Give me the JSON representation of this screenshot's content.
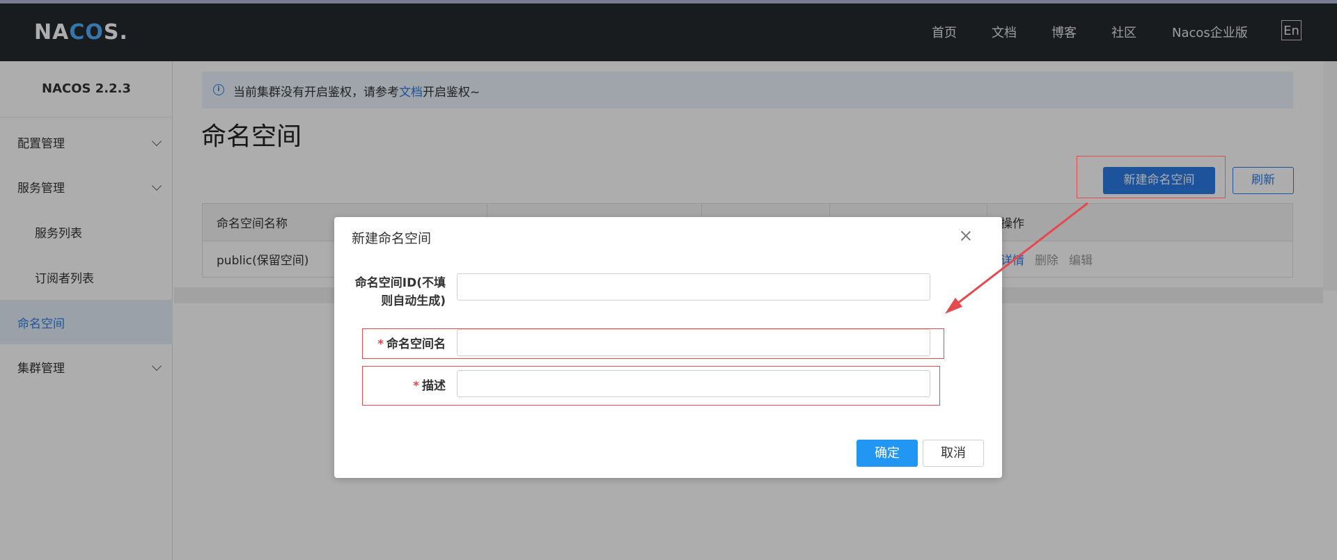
{
  "header": {
    "logo_prefix": "NA",
    "logo_accent": "CO",
    "logo_suffix": "S.",
    "nav": [
      "首页",
      "文档",
      "博客",
      "社区",
      "Nacos企业版"
    ],
    "lang_button": "En"
  },
  "sidebar": {
    "version": "NACOS 2.2.3",
    "items": [
      {
        "label": "配置管理",
        "expandable": true
      },
      {
        "label": "服务管理",
        "expandable": true
      },
      {
        "label": "服务列表",
        "expandable": false
      },
      {
        "label": "订阅者列表",
        "expandable": false
      },
      {
        "label": "命名空间",
        "expandable": false,
        "active": true
      },
      {
        "label": "集群管理",
        "expandable": true
      }
    ]
  },
  "notice": {
    "text_before": "当前集群没有开启鉴权，请参考",
    "link": "文档",
    "text_after": "开启鉴权~"
  },
  "page": {
    "title": "命名空间",
    "new_button": "新建命名空间",
    "refresh_button": "刷新"
  },
  "table": {
    "columns": [
      "命名空间名称",
      "",
      "",
      "",
      "操作"
    ],
    "rows": [
      {
        "name": "public(保留空间)",
        "ops": [
          "详情",
          "删除",
          "编辑"
        ]
      }
    ]
  },
  "modal": {
    "title": "新建命名空间",
    "fields": [
      {
        "label_line1": "命名空间ID(不填",
        "label_line2": "则自动生成)",
        "required": false,
        "value": ""
      },
      {
        "label": "命名空间名",
        "required": true,
        "value": ""
      },
      {
        "label": "描述",
        "required": true,
        "value": ""
      }
    ],
    "ok_button": "确定",
    "cancel_button": "取消"
  },
  "colors": {
    "primary": "#2c7be5",
    "header_bg": "#252a2f",
    "highlight": "#e5484d"
  }
}
